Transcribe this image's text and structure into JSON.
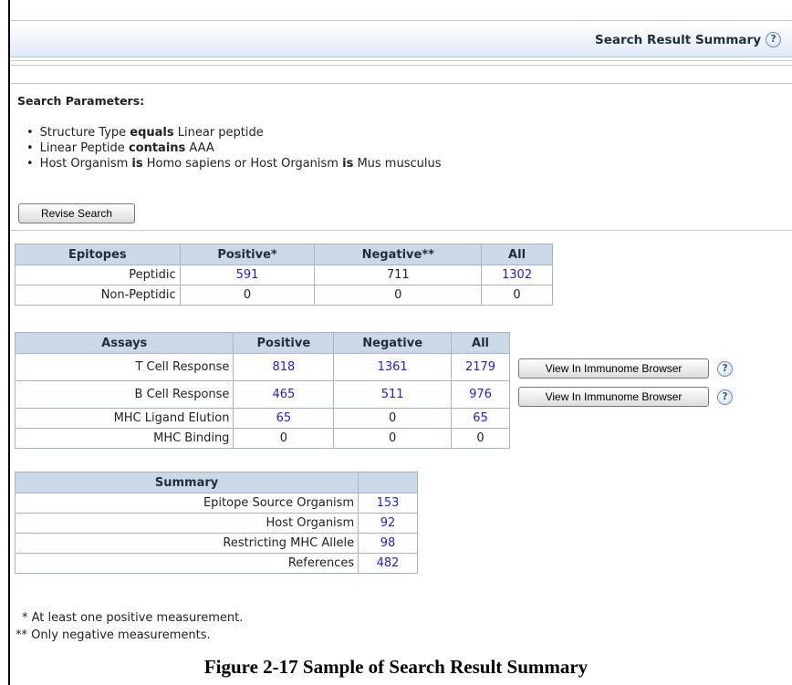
{
  "header": {
    "title": "Search Result Summary",
    "help_icon": "?"
  },
  "search_params": {
    "label": "Search Parameters:",
    "items": [
      {
        "pre": "Structure Type ",
        "op": "equals",
        "post": " Linear peptide",
        "op2": "",
        "post2": ""
      },
      {
        "pre": "Linear Peptide ",
        "op": "contains",
        "post": " AAA",
        "op2": "",
        "post2": ""
      },
      {
        "pre": "Host Organism ",
        "op": "is",
        "post": " Homo sapiens or Host Organism ",
        "op2": "is",
        "post2": " Mus musculus"
      }
    ],
    "revise_label": "Revise Search"
  },
  "epitopes": {
    "headers": [
      "Epitopes",
      "Positive*",
      "Negative**",
      "All"
    ],
    "rows": [
      {
        "label": "Peptidic",
        "positive": "591",
        "negative": "711",
        "all": "1302"
      },
      {
        "label": "Non-Peptidic",
        "positive": "0",
        "negative": "0",
        "all": "0"
      }
    ]
  },
  "assays": {
    "headers": [
      "Assays",
      "Positive",
      "Negative",
      "All"
    ],
    "rows": [
      {
        "label": "T Cell Response",
        "positive": "818",
        "negative": "1361",
        "all": "2179"
      },
      {
        "label": "B Cell Response",
        "positive": "465",
        "negative": "511",
        "all": "976"
      },
      {
        "label": "MHC Ligand Elution",
        "positive": "65",
        "negative": "0",
        "all": "65"
      },
      {
        "label": "MHC Binding",
        "positive": "0",
        "negative": "0",
        "all": "0"
      }
    ],
    "browser_button_label": "View In Immunome Browser"
  },
  "summary": {
    "header": "Summary",
    "rows": [
      {
        "label": "Epitope Source Organism",
        "value": "153"
      },
      {
        "label": "Host Organism",
        "value": "92"
      },
      {
        "label": "Restricting MHC Allele",
        "value": "98"
      },
      {
        "label": "References",
        "value": "482"
      }
    ]
  },
  "footnotes": {
    "one": "* At least one positive measurement.",
    "two": "** Only negative measurements."
  },
  "caption": "Figure 2-17  Sample of Search Result Summary",
  "colors": {
    "link": "#2222cc",
    "header_bg": "#cbd8e8",
    "border": "#a8b4c2"
  }
}
